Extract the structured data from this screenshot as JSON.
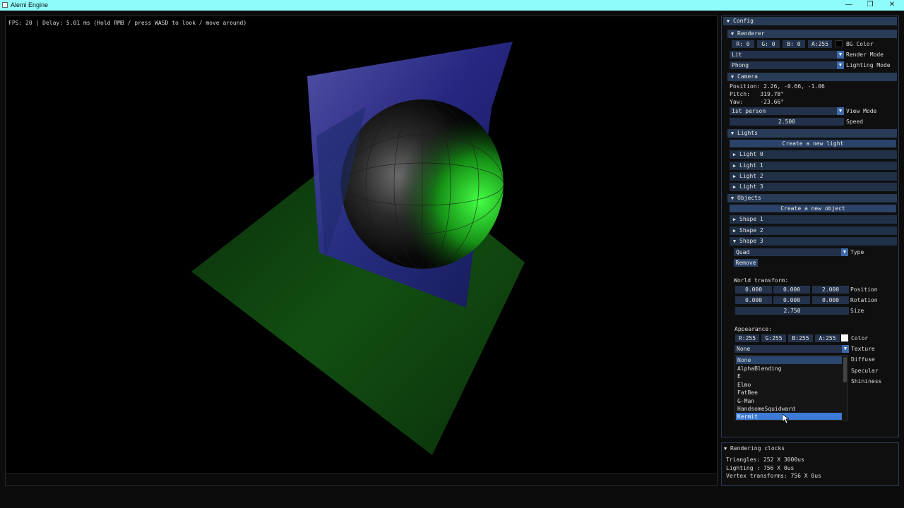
{
  "window": {
    "title": "Alemi Engine",
    "minimize": "—",
    "restore": "❐",
    "close": "✕"
  },
  "viewport": {
    "fps_text": "FPS: 20 | Delay: 5.01 ms (Hold RMB / press WASD to look / move around)"
  },
  "config": {
    "title": "Config",
    "renderer": {
      "header": "Renderer",
      "bg": {
        "r": "R: 0",
        "g": "G: 0",
        "b": "B: 0",
        "a": "A:255",
        "label": "BG Color",
        "swatch": "#000000"
      },
      "render_mode": {
        "value": "Lit",
        "label": "Render Mode"
      },
      "lighting_mode": {
        "value": "Phong",
        "label": "Lighting Mode"
      }
    },
    "camera": {
      "header": "Camera",
      "position": "Position: 2.26, -0.66, -1.06",
      "pitch": "Pitch:   319.78°",
      "yaw": "Yaw:     -23.66°",
      "view_mode": {
        "value": "1st person",
        "label": "View Mode"
      },
      "speed": {
        "value": "2.500",
        "label": "Speed"
      }
    },
    "lights": {
      "header": "Lights",
      "create_button": "Create a new light",
      "items": [
        "Light 0",
        "Light 1",
        "Light 2",
        "Light 3"
      ]
    },
    "objects": {
      "header": "Objects",
      "create_button": "Create a new object",
      "items": [
        "Shape 1",
        "Shape 2",
        "Shape 3"
      ],
      "shape3": {
        "type": {
          "value": "Quad",
          "label": "Type"
        },
        "remove_button": "Remove",
        "world_transform_label": "World transform:",
        "position": {
          "x": "0.000",
          "y": "0.000",
          "z": "2.000",
          "label": "Position"
        },
        "rotation": {
          "x": "0.000",
          "y": "0.000",
          "z": "0.000",
          "label": "Rotation"
        },
        "size": {
          "value": "2.750",
          "label": "Size"
        },
        "appearance_label": "Appearance:",
        "color": {
          "r": "R:255",
          "g": "G:255",
          "b": "B:255",
          "a": "A:255",
          "label": "Color",
          "swatch": "#ffffff"
        },
        "texture": {
          "value": "None",
          "label": "Texture"
        },
        "diffuse_label": "Diffuse",
        "specular_label": "Specular",
        "shininess_label": "Shininess",
        "texture_options": [
          "None",
          "AlphaBlending",
          "E",
          "Elmo",
          "FatBee",
          "G-Man",
          "HandsomeSquidward",
          "Kermit"
        ],
        "texture_selected": "None",
        "texture_hovered": "Kermit"
      }
    }
  },
  "clocks": {
    "header": "Rendering clocks",
    "triangles": "Triangles: 252 X 3000us",
    "lighting": "Lighting : 756 X 0us",
    "vertex": "Vertex transforms: 756 X 0us"
  },
  "colors": {
    "accent": "#3d7bd6",
    "header": "#283b57",
    "frame": "#23324a",
    "titlebar": "#8ffcfc"
  }
}
